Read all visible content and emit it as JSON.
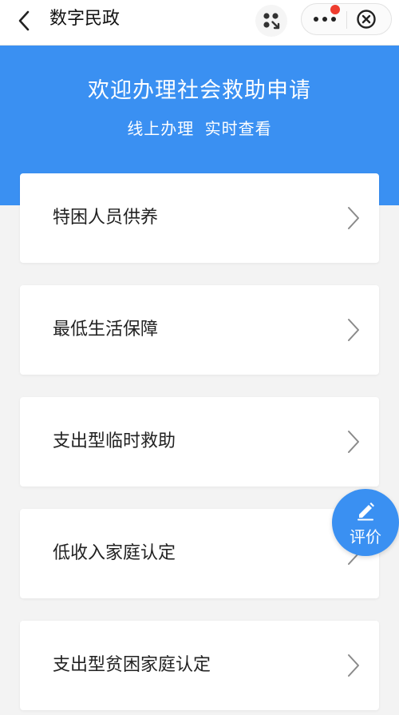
{
  "nav": {
    "title": "数字民政",
    "icons": {
      "back": "chevron-left-icon",
      "apps": "apps-icon",
      "more": "more-dots-icon",
      "close": "close-circle-icon"
    }
  },
  "hero": {
    "title": "欢迎办理社会救助申请",
    "subtitle": "线上办理 实时查看"
  },
  "services": [
    {
      "label": "特困人员供养"
    },
    {
      "label": "最低生活保障"
    },
    {
      "label": "支出型临时救助"
    },
    {
      "label": "低收入家庭认定"
    },
    {
      "label": "支出型贫困家庭认定"
    }
  ],
  "rate_button": {
    "label": "评价"
  },
  "colors": {
    "brand_blue": "#3a90f2",
    "badge_red": "#ee3d2f",
    "page_bg": "#f3f3f3"
  }
}
